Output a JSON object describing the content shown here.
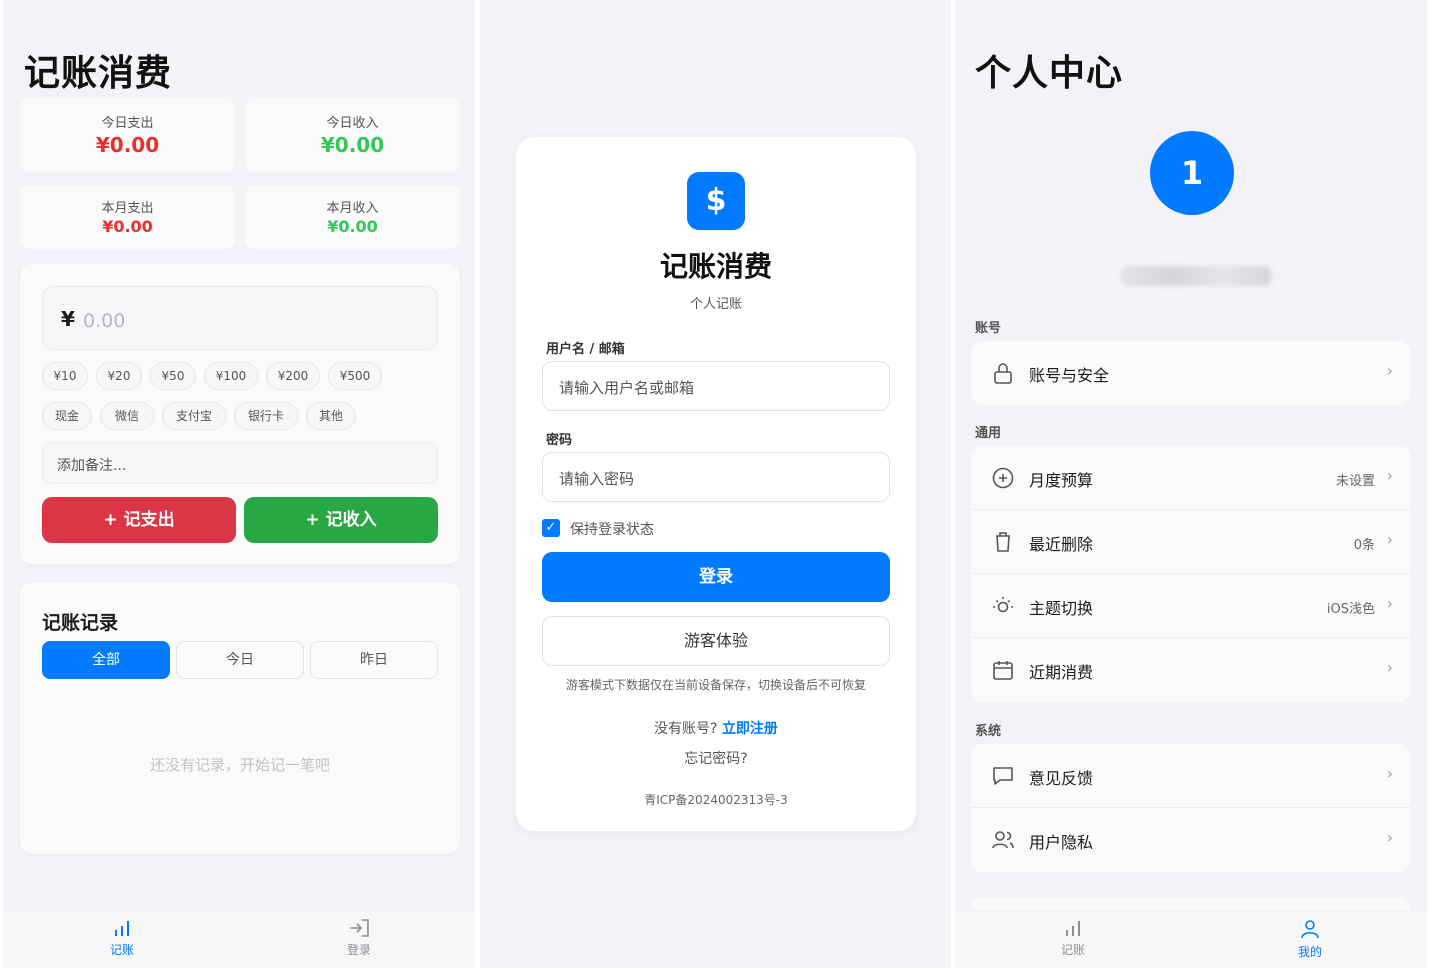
{
  "left": {
    "title": "记账消费",
    "stats": [
      {
        "label": "今日支出",
        "value": "¥0.00"
      },
      {
        "label": "今日收入",
        "value": "¥0.00"
      },
      {
        "label": "本月支出",
        "value": "¥0.00"
      },
      {
        "label": "本月收入",
        "value": "¥0.00"
      }
    ],
    "currency": "¥",
    "amount_placeholder": "0.00",
    "quick_amounts": [
      "¥10",
      "¥20",
      "¥50",
      "¥100",
      "¥200",
      "¥500"
    ],
    "payment_methods": [
      "现金",
      "微信",
      "支付宝",
      "银行卡",
      "其他"
    ],
    "memo_placeholder": "添加备注...",
    "expense_button": "+ 记支出",
    "income_button": "+ 记收入",
    "records_title": "记账记录",
    "filters": [
      "全部",
      "今日",
      "昨日"
    ],
    "empty_text": "还没有记录，开始记一笔吧",
    "tabs": [
      "记账",
      "登录"
    ]
  },
  "login": {
    "logo_symbol": "$",
    "title": "记账消费",
    "subtitle": "个人记账",
    "username_label": "用户名 / 邮箱",
    "username_placeholder": "请输入用户名或邮箱",
    "password_label": "密码",
    "password_placeholder": "请输入密码",
    "remember_label": "保持登录状态",
    "login_button": "登录",
    "guest_button": "游客体验",
    "guest_note": "游客模式下数据仅在当前设备保存，切换设备后不可恢复",
    "no_account": "没有账号?",
    "register_link": "立即注册",
    "forgot_link": "忘记密码?",
    "icp": "青ICP备2024002313号-3"
  },
  "profile": {
    "title": "个人中心",
    "avatar_text": "1",
    "sections": [
      {
        "label": "账号",
        "rows": [
          {
            "icon": "lock-icon",
            "text": "账号与安全",
            "right": ""
          }
        ]
      },
      {
        "label": "通用",
        "rows": [
          {
            "icon": "plus-circle-icon",
            "text": "月度预算",
            "right": "未设置"
          },
          {
            "icon": "trash-icon",
            "text": "最近删除",
            "right": "0条"
          },
          {
            "icon": "sun-icon",
            "text": "主题切换",
            "right": "iOS浅色"
          },
          {
            "icon": "calendar-icon",
            "text": "近期消费",
            "right": ""
          }
        ]
      },
      {
        "label": "系统",
        "rows": [
          {
            "icon": "chat-icon",
            "text": "意见反馈",
            "right": ""
          },
          {
            "icon": "users-icon",
            "text": "用户隐私",
            "right": ""
          }
        ]
      }
    ],
    "tabs": [
      "记账",
      "我的"
    ]
  },
  "colors": {
    "accent": "#007aff",
    "expense": "#e8302f",
    "income": "#34c759",
    "expense_button": "#dc3545",
    "income_button": "#28a745"
  }
}
